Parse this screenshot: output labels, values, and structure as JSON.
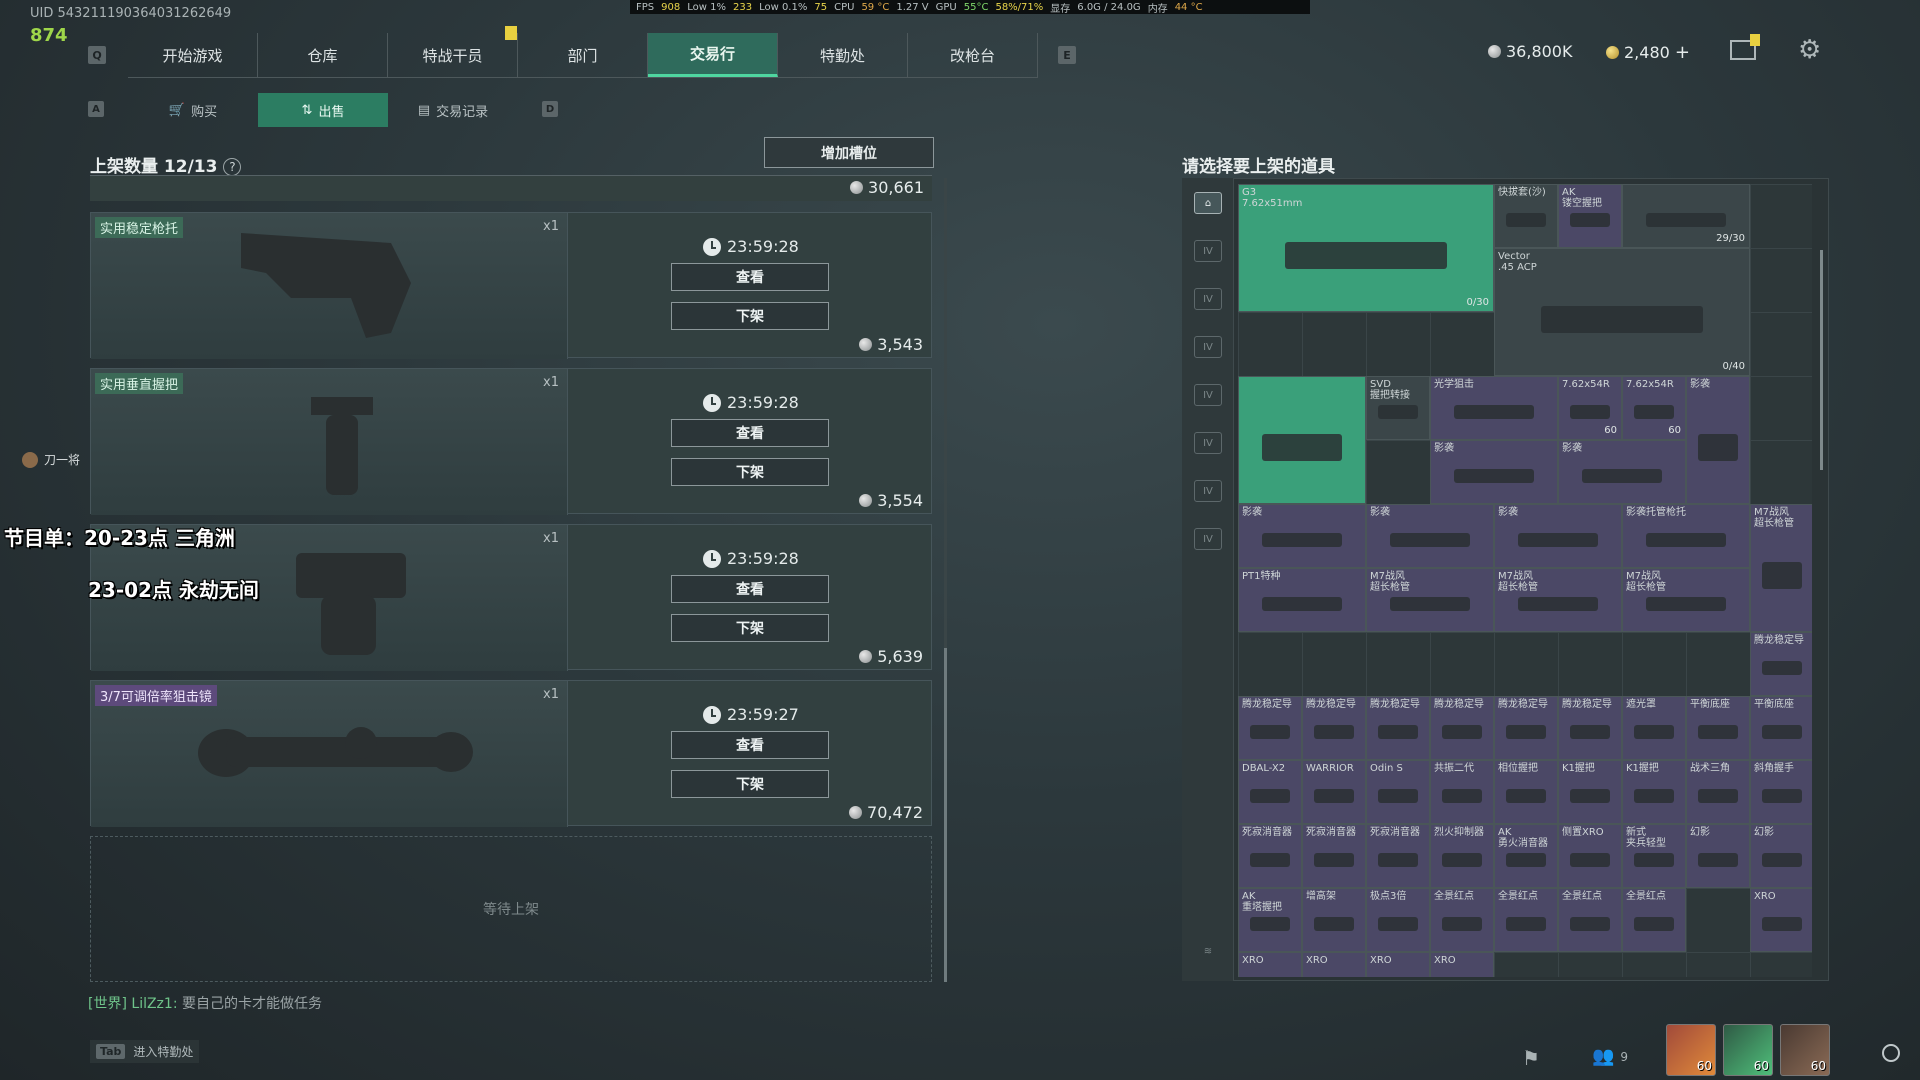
{
  "hud": {
    "uid": "UID 543211190364031262649",
    "counter": "874",
    "stats": {
      "fps_label": "FPS",
      "fps": "908",
      "low1_label": "Low 1%",
      "low1": "233",
      "low01_label": "Low 0.1%",
      "low01": "75",
      "cpu_label": "CPU",
      "cpu_temp": "59 °C",
      "volt": "1.27 V",
      "gpu_label": "GPU",
      "gpu_temp": "55°C",
      "gpu_load": "58%/71%",
      "vram_label": "显存",
      "vram": "6.0G / 24.0G",
      "mem_label": "内存",
      "mem_temp": "44 °C"
    }
  },
  "topnav": {
    "left_key": "Q",
    "right_key": "E",
    "tabs": [
      "开始游戏",
      "仓库",
      "特战干员",
      "部门",
      "交易行",
      "特勤处",
      "改枪台"
    ],
    "active": "交易行"
  },
  "currency": {
    "silver": "36,800K",
    "gold": "2,480",
    "plus": "+"
  },
  "subnav": {
    "left_key": "A",
    "right_key": "D",
    "tabs": [
      {
        "icon": "cart-icon",
        "label": "购买"
      },
      {
        "icon": "sell-icon",
        "label": "出售"
      },
      {
        "icon": "record-icon",
        "label": "交易记录"
      }
    ],
    "active": "出售"
  },
  "listing": {
    "header": "上架数量 12/13",
    "help": "?",
    "add_slot": "增加槽位",
    "top_price": "30,661",
    "view_label": "查看",
    "delist_label": "下架",
    "cards": [
      {
        "name": "实用稳定枪托",
        "qty": "x1",
        "timer": "23:59:28",
        "price": "3,543",
        "rarity": "green"
      },
      {
        "name": "实用垂直握把",
        "qty": "x1",
        "timer": "23:59:28",
        "price": "3,554",
        "rarity": "green"
      },
      {
        "name": "",
        "qty": "x1",
        "timer": "23:59:28",
        "price": "5,639",
        "rarity": "green"
      },
      {
        "name": "3/7可调倍率狙击镜",
        "qty": "x1",
        "timer": "23:59:27",
        "price": "70,472",
        "rarity": "purple"
      }
    ],
    "waiting": "等待上架"
  },
  "overlay": {
    "line1": "节目单：20-23点 三角洲",
    "line2": "23-02点 永劫无间"
  },
  "side_user": {
    "name": "刀一将"
  },
  "chat": {
    "channel": "[世界]",
    "user": "LilZz1:",
    "message": "要自己的卡才能做任务"
  },
  "tab_hint": {
    "key": "Tab",
    "label": "进入特勤处"
  },
  "inventory": {
    "title": "请选择要上架的道具",
    "side_tabs": [
      "IV",
      "IV",
      "IV",
      "IV",
      "IV",
      "IV",
      "IV"
    ],
    "items": [
      {
        "label": "G3\n7.62x51mm",
        "count": "0/30",
        "color": "green"
      },
      {
        "label": "快拔套(沙)",
        "count": "",
        "color": "gray"
      },
      {
        "label": "AK\n镂空握把",
        "count": "",
        "color": "purple"
      },
      {
        "label": "",
        "count": "29/30",
        "color": "gray"
      },
      {
        "label": "Vector\n.45 ACP",
        "count": "0/40",
        "color": "gray"
      },
      {
        "label": "",
        "count": "",
        "color": "green"
      },
      {
        "label": "SVD\n握把转接",
        "count": "",
        "color": "gray"
      },
      {
        "label": "光学狙击",
        "count": "",
        "color": "purple"
      },
      {
        "label": "7.62x54R",
        "count": "60",
        "color": "purple"
      },
      {
        "label": "7.62x54R",
        "count": "60",
        "color": "purple"
      },
      {
        "label": "影袭",
        "count": "",
        "color": "purple"
      },
      {
        "label": "影袭",
        "count": "",
        "color": "purple"
      },
      {
        "label": "影袭",
        "count": "",
        "color": "purple"
      },
      {
        "label": "影袭",
        "count": "",
        "color": "purple"
      },
      {
        "label": "影袭",
        "count": "",
        "color": "purple"
      },
      {
        "label": "影袭",
        "count": "",
        "color": "purple"
      },
      {
        "label": "影袭托管枪托",
        "count": "",
        "color": "purple"
      },
      {
        "label": "M7战风\n超长枪管",
        "count": "",
        "color": "purple"
      },
      {
        "label": "PT1特种",
        "count": "",
        "color": "purple"
      },
      {
        "label": "M7战风\n超长枪管",
        "count": "",
        "color": "purple"
      },
      {
        "label": "M7战风\n超长枪管",
        "count": "",
        "color": "purple"
      },
      {
        "label": "M7战风\n超长枪管",
        "count": "",
        "color": "purple"
      },
      {
        "label": "腾龙稳定导",
        "count": "",
        "color": "purple"
      },
      {
        "label": "腾龙稳定导",
        "count": "",
        "color": "purple"
      },
      {
        "label": "腾龙稳定导",
        "count": "",
        "color": "purple"
      },
      {
        "label": "腾龙稳定导",
        "count": "",
        "color": "purple"
      },
      {
        "label": "腾龙稳定导",
        "count": "",
        "color": "purple"
      },
      {
        "label": "腾龙稳定导",
        "count": "",
        "color": "purple"
      },
      {
        "label": "腾龙稳定导",
        "count": "",
        "color": "purple"
      },
      {
        "label": "遮光罩",
        "count": "",
        "color": "purple"
      },
      {
        "label": "平衡底座",
        "count": "",
        "color": "purple"
      },
      {
        "label": "平衡底座",
        "count": "",
        "color": "purple"
      },
      {
        "label": "DBAL-X2",
        "count": "",
        "color": "purple"
      },
      {
        "label": "WARRIOR",
        "count": "",
        "color": "purple"
      },
      {
        "label": "Odin S",
        "count": "",
        "color": "purple"
      },
      {
        "label": "共振二代",
        "count": "",
        "color": "purple"
      },
      {
        "label": "相位握把",
        "count": "",
        "color": "purple"
      },
      {
        "label": "K1握把",
        "count": "",
        "color": "purple"
      },
      {
        "label": "K1握把",
        "count": "",
        "color": "purple"
      },
      {
        "label": "战术三角",
        "count": "",
        "color": "purple"
      },
      {
        "label": "斜角握手",
        "count": "",
        "color": "purple"
      },
      {
        "label": "死寂消音器",
        "count": "",
        "color": "purple"
      },
      {
        "label": "死寂消音器",
        "count": "",
        "color": "purple"
      },
      {
        "label": "死寂消音器",
        "count": "",
        "color": "purple"
      },
      {
        "label": "烈火抑制器",
        "count": "",
        "color": "purple"
      },
      {
        "label": "AK\n勇火消音器",
        "count": "",
        "color": "purple"
      },
      {
        "label": "侧置XRO",
        "count": "",
        "color": "purple"
      },
      {
        "label": "新式\n夹兵轻型",
        "count": "",
        "color": "purple"
      },
      {
        "label": "幻影",
        "count": "",
        "color": "purple"
      },
      {
        "label": "幻影",
        "count": "",
        "color": "purple"
      },
      {
        "label": "AK\n重塔握把",
        "count": "",
        "color": "purple"
      },
      {
        "label": "增高架",
        "count": "",
        "color": "purple"
      },
      {
        "label": "极点3倍",
        "count": "",
        "color": "purple"
      },
      {
        "label": "全景红点",
        "count": "",
        "color": "purple"
      },
      {
        "label": "全景红点",
        "count": "",
        "color": "purple"
      },
      {
        "label": "全景红点",
        "count": "",
        "color": "purple"
      },
      {
        "label": "全景红点",
        "count": "",
        "color": "purple"
      },
      {
        "label": "XRO",
        "count": "",
        "color": "purple"
      },
      {
        "label": "XRO",
        "count": "",
        "color": "purple"
      },
      {
        "label": "XRO",
        "count": "",
        "color": "purple"
      },
      {
        "label": "XRO",
        "count": "",
        "color": "purple"
      },
      {
        "label": "XRO",
        "count": "",
        "color": "purple"
      }
    ]
  },
  "bottom_right": {
    "friends": "9",
    "avatars": [
      {
        "level": "60"
      },
      {
        "level": "60"
      },
      {
        "level": "60"
      }
    ]
  }
}
